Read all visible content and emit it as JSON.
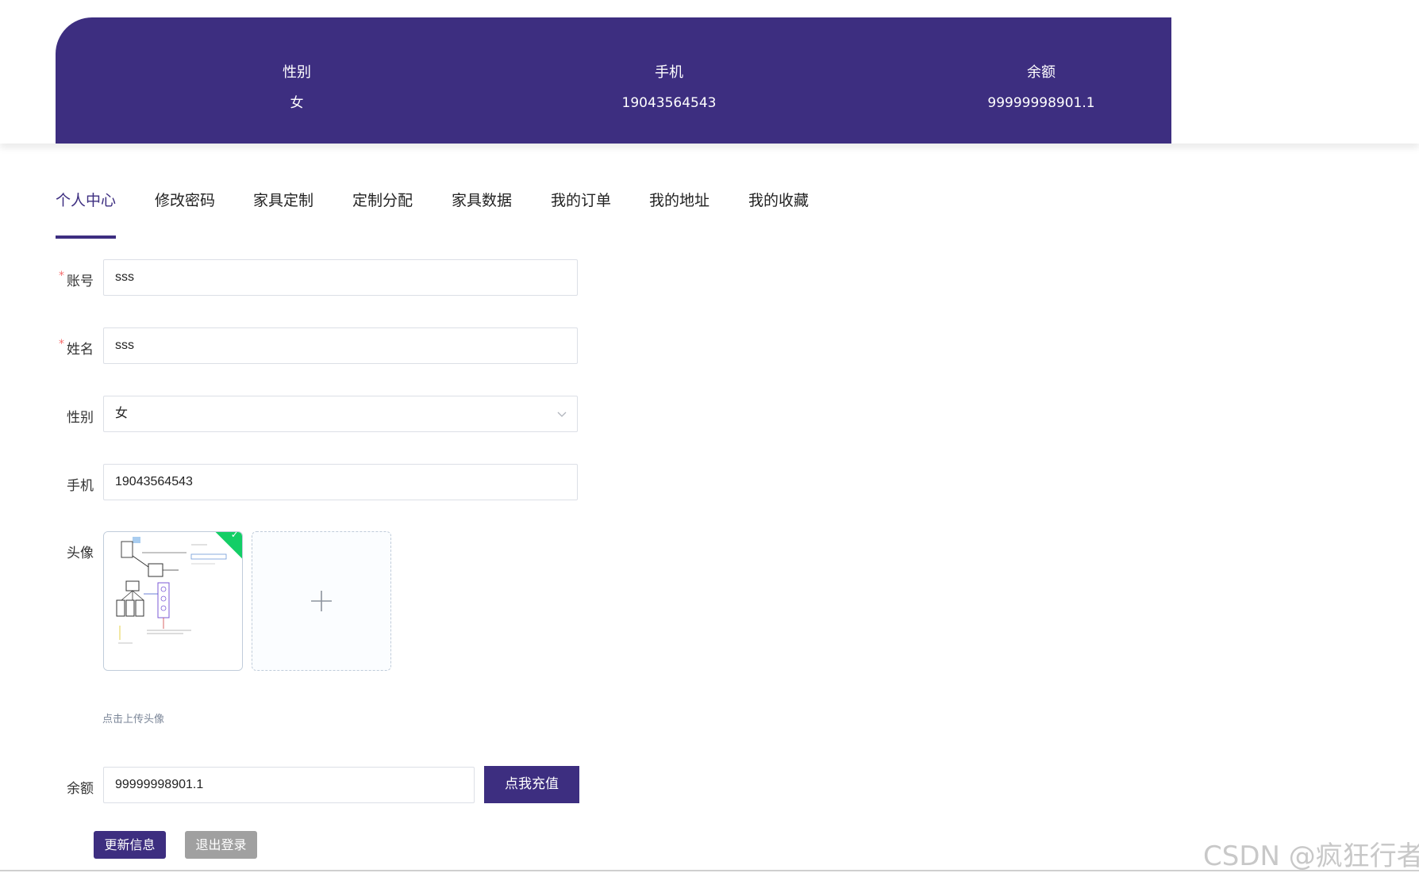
{
  "banner": {
    "stats": [
      {
        "label": "性别",
        "value": "女"
      },
      {
        "label": "手机",
        "value": "19043564543"
      },
      {
        "label": "余额",
        "value": "99999998901.1"
      }
    ]
  },
  "tabs": [
    {
      "label": "个人中心",
      "active": true
    },
    {
      "label": "修改密码"
    },
    {
      "label": "家具定制"
    },
    {
      "label": "定制分配"
    },
    {
      "label": "家具数据"
    },
    {
      "label": "我的订单"
    },
    {
      "label": "我的地址"
    },
    {
      "label": "我的收藏"
    }
  ],
  "form": {
    "account": {
      "label": "账号",
      "value": "sss",
      "required": "*"
    },
    "name": {
      "label": "姓名",
      "value": "sss",
      "required": "*"
    },
    "gender": {
      "label": "性别",
      "value": "女"
    },
    "phone": {
      "label": "手机",
      "value": "19043564543"
    },
    "avatar": {
      "label": "头像",
      "tip": "点击上传头像"
    },
    "balance": {
      "label": "余额",
      "value": "99999998901.1",
      "recharge_label": "点我充值"
    }
  },
  "actions": {
    "update_label": "更新信息",
    "logout_label": "退出登录"
  },
  "watermark": "CSDN @疯狂行者",
  "colors": {
    "brand": "#3d2e80",
    "success": "#13ce66",
    "required": "#f56c6c"
  }
}
